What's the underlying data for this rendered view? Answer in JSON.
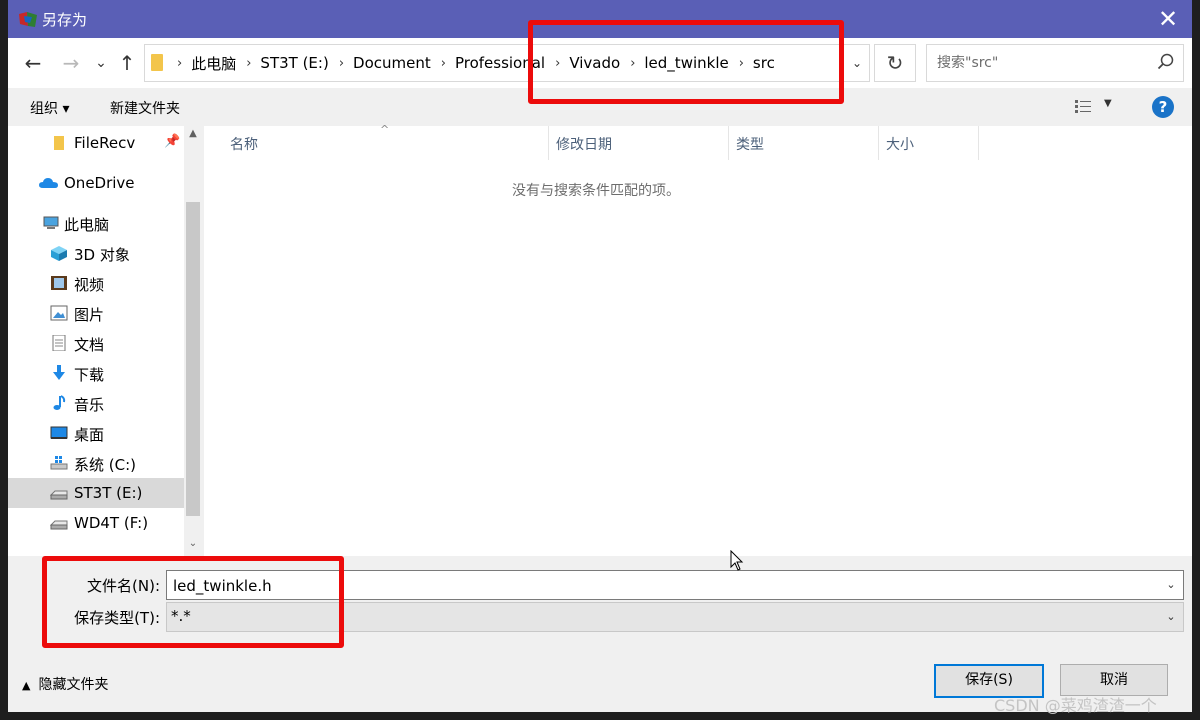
{
  "dialog": {
    "title": "另存为",
    "close_symbol": "✕"
  },
  "nav": {
    "back": "←",
    "forward": "→",
    "recent": "⌄",
    "up": "↑",
    "breadcrumb": [
      "此电脑",
      "ST3T (E:)",
      "Document",
      "Professional",
      "Vivado",
      "led_twinkle",
      "src"
    ],
    "refresh": "↻"
  },
  "search": {
    "placeholder": "搜索\"src\""
  },
  "toolbar": {
    "organize": "组织 ▾",
    "new_folder": "新建文件夹",
    "help": "?"
  },
  "sidebar": {
    "items": [
      {
        "label": "FileRecv",
        "icon": "folder-icon",
        "pinned": true
      },
      {
        "label": "OneDrive",
        "icon": "cloud-icon"
      },
      {
        "label": "此电脑",
        "icon": "computer-icon"
      },
      {
        "label": "3D 对象",
        "icon": "cube-icon"
      },
      {
        "label": "视频",
        "icon": "video-icon"
      },
      {
        "label": "图片",
        "icon": "picture-icon"
      },
      {
        "label": "文档",
        "icon": "document-icon"
      },
      {
        "label": "下载",
        "icon": "download-icon"
      },
      {
        "label": "音乐",
        "icon": "music-icon"
      },
      {
        "label": "桌面",
        "icon": "desktop-icon"
      },
      {
        "label": "系统 (C:)",
        "icon": "system-drive-icon"
      },
      {
        "label": "ST3T (E:)",
        "icon": "drive-icon",
        "selected": true
      },
      {
        "label": "WD4T (F:)",
        "icon": "drive-icon"
      }
    ]
  },
  "filelist": {
    "columns": [
      "名称",
      "修改日期",
      "类型",
      "大小"
    ],
    "empty_message": "没有与搜索条件匹配的项。"
  },
  "save": {
    "filename_label": "文件名(N):",
    "filename_value": "led_twinkle.h",
    "filetype_label": "保存类型(T):",
    "filetype_value": "*.*",
    "hide_folders": "隐藏文件夹",
    "save_button": "保存(S)",
    "cancel_button": "取消"
  },
  "colors": {
    "titlebar": "#5a5fb6",
    "highlight_box": "#ec0b0b",
    "primary_button_border": "#0078d7"
  },
  "watermark": "CSDN @菜鸡渣渣一个"
}
